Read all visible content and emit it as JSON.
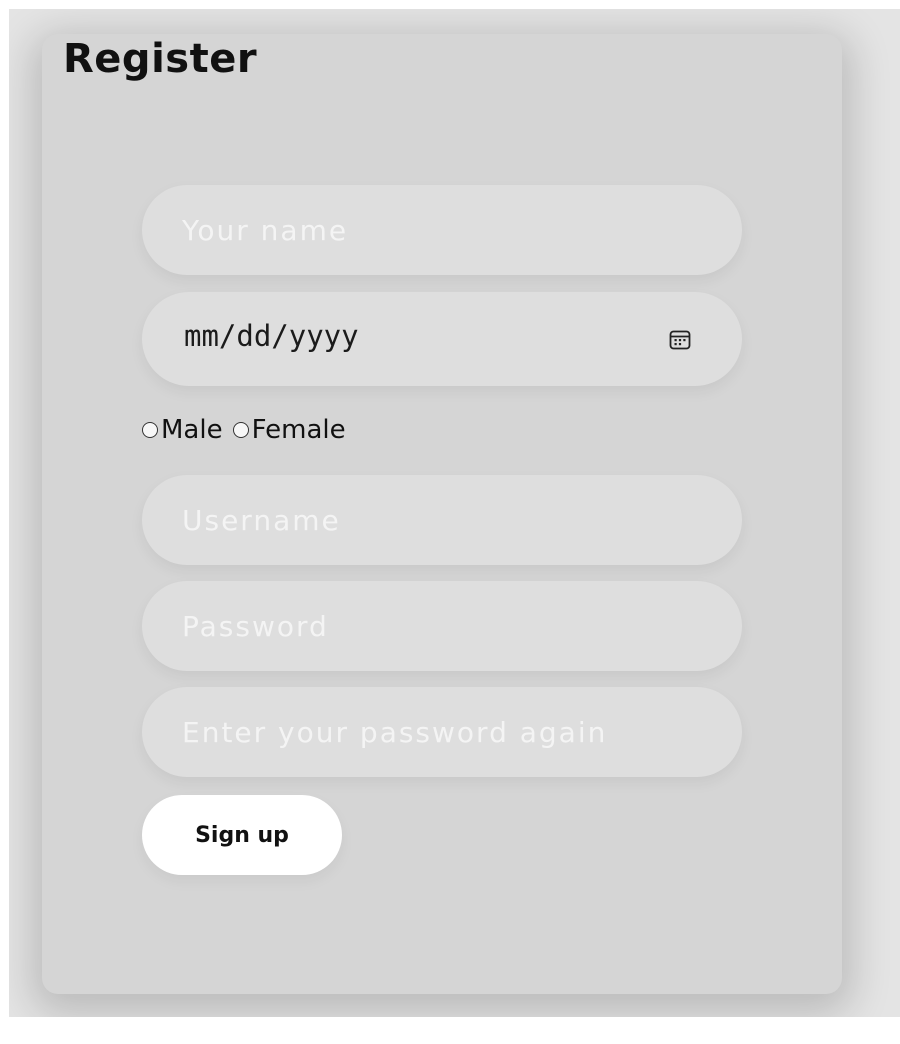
{
  "form": {
    "title": "Register",
    "name_placeholder": "Your name",
    "date_placeholder": "mm/dd/yyyy",
    "gender_options": [
      {
        "label": "Male",
        "selected": false
      },
      {
        "label": "Female",
        "selected": false
      }
    ],
    "username_placeholder": "Username",
    "password_placeholder": "Password",
    "confirm_password_placeholder": "Enter your password again",
    "submit_label": "Sign up"
  },
  "icons": {
    "date_picker": "calendar-icon",
    "radio": "radio-unchecked-icon"
  },
  "colors": {
    "page_background": "#e4e4e4",
    "card_background": "#d5d5d5",
    "field_background": "#dedede",
    "placeholder_text": "#f4f4f4",
    "button_background": "#ffffff",
    "text": "#111111"
  }
}
